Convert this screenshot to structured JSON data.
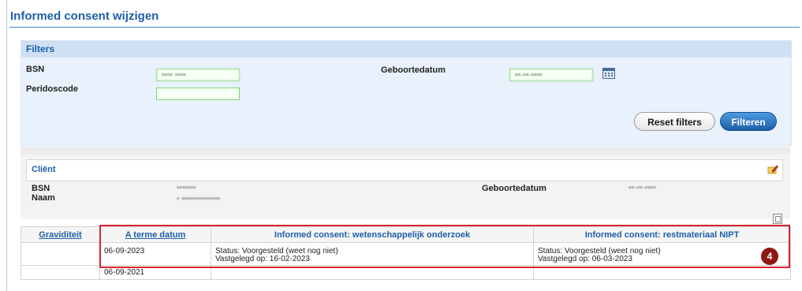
{
  "page": {
    "title": "Informed consent wijzigen"
  },
  "filters": {
    "header": "Filters",
    "bsn_label": "BSN",
    "bsn_value": "•••• ••••",
    "perido_label": "Peridoscode",
    "perido_value": "",
    "dob_label": "Geboortedatum",
    "dob_value": "••-••-••••",
    "reset_label": "Reset filters",
    "filter_label": "Filteren"
  },
  "client": {
    "title": "Cliënt",
    "bsn_label": "BSN",
    "naam_label": "Naam",
    "dob_label": "Geboortedatum",
    "bsn_value": "•••••••",
    "naam_value": "• ••••••••••••••",
    "dob_value": "••-••-••••"
  },
  "table": {
    "headers": [
      "Graviditeit",
      "A terme datum",
      "Informed consent: wetenschappelijk onderzoek",
      "Informed consent: restmateriaal NIPT"
    ],
    "rows": [
      {
        "graviditeit": "",
        "aterme": "06-09-2023",
        "wet_status": "Status: Voorgesteld (weet nog niet)",
        "wet_vastgelegd": "Vastgelegd op: 16-02-2023",
        "nipt_status": "Status: Voorgesteld (weet nog niet)",
        "nipt_vastgelegd": "Vastgelegd op: 06-03-2023"
      },
      {
        "graviditeit": "",
        "aterme": "06-09-2021",
        "wet_status": "",
        "wet_vastgelegd": "",
        "nipt_status": "",
        "nipt_vastgelegd": ""
      }
    ]
  },
  "annotation": {
    "badge": "4",
    "color": "#d6262f"
  }
}
